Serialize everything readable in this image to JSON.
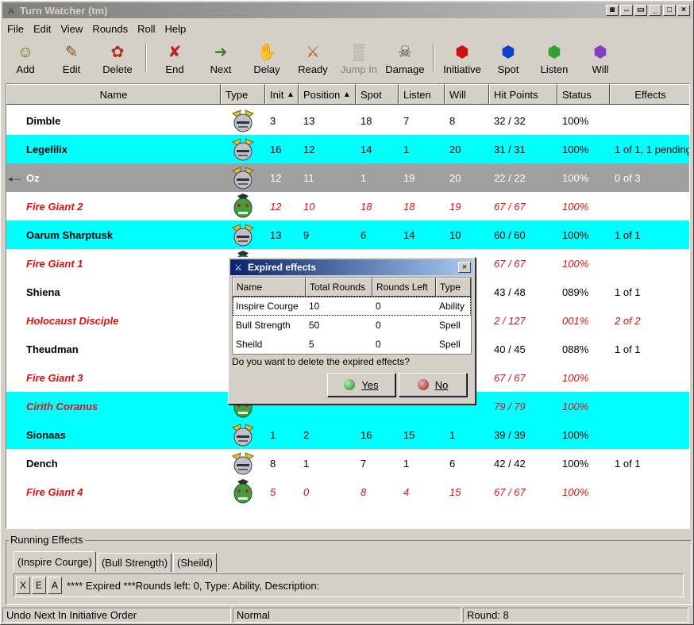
{
  "window": {
    "title": "Turn Watcher (tm)"
  },
  "menu": [
    "File",
    "Edit",
    "View",
    "Rounds",
    "Roll",
    "Help"
  ],
  "toolbar": [
    {
      "label": "Add",
      "icon": "add-icon",
      "enabled": true
    },
    {
      "label": "Edit",
      "icon": "edit-icon",
      "enabled": true
    },
    {
      "label": "Delete",
      "icon": "delete-icon",
      "enabled": true
    },
    {
      "label": "End",
      "icon": "end-icon",
      "enabled": true
    },
    {
      "label": "Next",
      "icon": "next-icon",
      "enabled": true
    },
    {
      "label": "Delay",
      "icon": "delay-icon",
      "enabled": true
    },
    {
      "label": "Ready",
      "icon": "ready-icon",
      "enabled": true
    },
    {
      "label": "Jump In",
      "icon": "jump-in-icon",
      "enabled": false
    },
    {
      "label": "Damage",
      "icon": "damage-icon",
      "enabled": true
    },
    {
      "label": "Initiative",
      "icon": "initiative-die-icon",
      "enabled": true,
      "color": "#d01010"
    },
    {
      "label": "Spot",
      "icon": "spot-die-icon",
      "enabled": true,
      "color": "#1040d0"
    },
    {
      "label": "Listen",
      "icon": "listen-die-icon",
      "enabled": true,
      "color": "#30a030"
    },
    {
      "label": "Will",
      "icon": "will-die-icon",
      "enabled": true,
      "color": "#8040c0"
    }
  ],
  "grid": {
    "columns": [
      "Name",
      "Type",
      "Init",
      "Position",
      "Spot",
      "Listen",
      "Will",
      "Hit Points",
      "Status",
      "Effects"
    ],
    "sort_indicators": {
      "Init": "▲",
      "Position": "▲"
    },
    "rows": [
      {
        "name": "Dimble",
        "type": "pc",
        "init": "3",
        "position": "13",
        "spot": "18",
        "listen": "7",
        "will": "8",
        "hp": "32 / 32",
        "status": "100%",
        "effects": "",
        "style": "white"
      },
      {
        "name": "Legelilix",
        "type": "pc",
        "init": "16",
        "position": "12",
        "spot": "14",
        "listen": "1",
        "will": "20",
        "hp": "31 / 31",
        "status": "100%",
        "effects": "1 of 1, 1 pending",
        "style": "cyan"
      },
      {
        "name": "Oz",
        "type": "pc",
        "init": "12",
        "position": "11",
        "spot": "1",
        "listen": "19",
        "will": "20",
        "hp": "22 / 22",
        "status": "100%",
        "effects": "0 of 3",
        "style": "gray",
        "current": true
      },
      {
        "name": "Fire Giant 2",
        "type": "monster",
        "init": "12",
        "position": "10",
        "spot": "18",
        "listen": "18",
        "will": "19",
        "hp": "67 / 67",
        "status": "100%",
        "effects": "",
        "style": "white",
        "giant": true
      },
      {
        "name": "Oarum Sharptusk",
        "type": "pc",
        "init": "13",
        "position": "9",
        "spot": "6",
        "listen": "14",
        "will": "10",
        "hp": "60 / 60",
        "status": "100%",
        "effects": "1 of 1",
        "style": "cyan"
      },
      {
        "name": "Fire Giant 1",
        "type": "monster",
        "init": "",
        "position": "",
        "spot": "",
        "listen": "",
        "will": "",
        "hp": "67 / 67",
        "status": "100%",
        "effects": "",
        "style": "white",
        "giant": true
      },
      {
        "name": "Shiena",
        "type": "pc",
        "init": "",
        "position": "",
        "spot": "",
        "listen": "",
        "will": "",
        "hp": "43 / 48",
        "status": "089%",
        "effects": "1 of 1",
        "style": "white"
      },
      {
        "name": "Holocaust Disciple",
        "type": "monster",
        "init": "",
        "position": "",
        "spot": "",
        "listen": "",
        "will": "",
        "hp": "2 / 127",
        "status": "001%",
        "effects": "2 of 2",
        "style": "white",
        "giant": true
      },
      {
        "name": "Theudman",
        "type": "pc",
        "init": "",
        "position": "",
        "spot": "",
        "listen": "",
        "will": "",
        "hp": "40 / 45",
        "status": "088%",
        "effects": "1 of 1",
        "style": "white"
      },
      {
        "name": "Fire Giant 3",
        "type": "monster",
        "init": "",
        "position": "",
        "spot": "",
        "listen": "",
        "will": "",
        "hp": "67 / 67",
        "status": "100%",
        "effects": "",
        "style": "white",
        "giant": true
      },
      {
        "name": "Cirith Coranus",
        "type": "monster",
        "init": "",
        "position": "",
        "spot": "",
        "listen": "",
        "will": "",
        "hp": "79 / 79",
        "status": "100%",
        "effects": "",
        "style": "cyan",
        "giant": true
      },
      {
        "name": "Sionaas",
        "type": "pc",
        "init": "1",
        "position": "2",
        "spot": "16",
        "listen": "15",
        "will": "1",
        "hp": "39 / 39",
        "status": "100%",
        "effects": "",
        "style": "cyan"
      },
      {
        "name": "Dench",
        "type": "pc",
        "init": "8",
        "position": "1",
        "spot": "7",
        "listen": "1",
        "will": "6",
        "hp": "42 / 42",
        "status": "100%",
        "effects": "1 of 1",
        "style": "white"
      },
      {
        "name": "Fire Giant 4",
        "type": "monster",
        "init": "5",
        "position": "0",
        "spot": "8",
        "listen": "4",
        "will": "15",
        "hp": "67 / 67",
        "status": "100%",
        "effects": "",
        "style": "white",
        "giant": true
      }
    ]
  },
  "running_effects": {
    "label": "Running Effects",
    "tabs": [
      "(Inspire Courge)",
      "(Bull Strength)",
      "(Sheild)"
    ],
    "buttons": [
      "X",
      "E",
      "A"
    ],
    "text": "**** Expired ***Rounds left: 0, Type: Ability, Description:"
  },
  "statusbar": {
    "left": "Undo Next In Initiative Order",
    "middle": "Normal",
    "right": "Round: 8"
  },
  "dialog": {
    "title": "Expired effects",
    "columns": [
      "Name",
      "Total Rounds",
      "Rounds Left",
      "Type"
    ],
    "rows": [
      {
        "name": "Inspire Courge",
        "total": "10",
        "left": "0",
        "type": "Ability"
      },
      {
        "name": "Bull Strength",
        "total": "50",
        "left": "0",
        "type": "Spell"
      },
      {
        "name": "Sheild",
        "total": "5",
        "left": "0",
        "type": "Spell"
      }
    ],
    "question": "Do you want to delete the expired effects?",
    "yes": "Yes",
    "no": "No"
  },
  "colors": {
    "highlight": "#00ffff",
    "current_row": "#a0a0a0",
    "giant_text": "#e01010"
  }
}
